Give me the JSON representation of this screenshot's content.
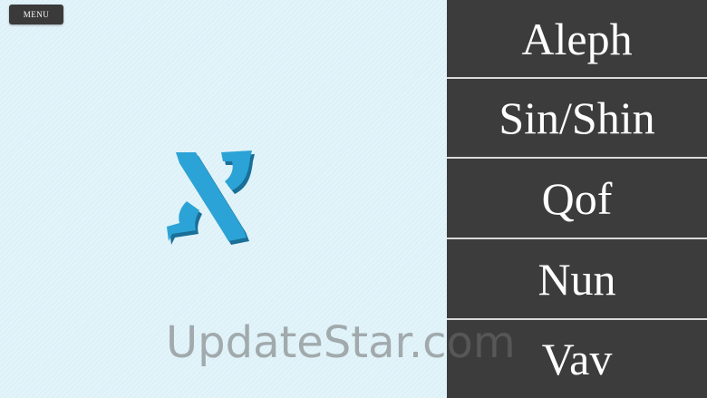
{
  "menu": {
    "label": "MENU"
  },
  "letter": {
    "glyph": "א",
    "color": "#2ba3d6",
    "shadow_color": "#1a6f99"
  },
  "answers": [
    {
      "label": "Aleph"
    },
    {
      "label": "Sin/Shin"
    },
    {
      "label": "Qof"
    },
    {
      "label": "Nun"
    },
    {
      "label": "Vav"
    }
  ],
  "watermark": {
    "text": "UpdateStar.com"
  },
  "colors": {
    "background": "#ddf1f8",
    "tile": "#3c3c3c",
    "tile_text": "#ffffff",
    "divider": "#d9d9d9"
  }
}
